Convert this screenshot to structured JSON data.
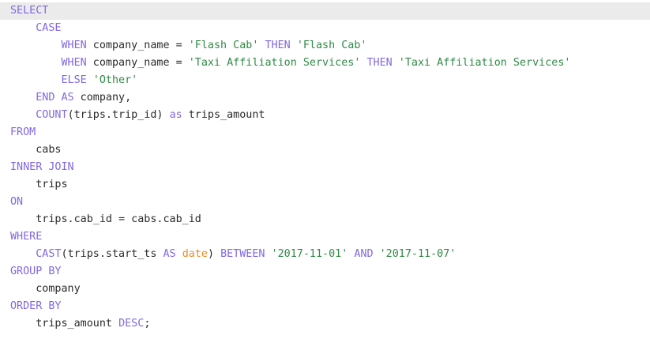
{
  "editor": {
    "active_line": 0,
    "colors": {
      "keyword": "#8268e0",
      "string": "#2f8a46",
      "type": "#ee8a1a",
      "text": "#2b2b2b",
      "active_line_bg": "#ebebeb"
    },
    "lines": [
      {
        "indent": 0,
        "tokens": [
          {
            "t": "kw",
            "v": "SELECT"
          }
        ]
      },
      {
        "indent": 4,
        "tokens": [
          {
            "t": "kw",
            "v": "CASE"
          }
        ]
      },
      {
        "indent": 8,
        "tokens": [
          {
            "t": "kw",
            "v": "WHEN"
          },
          {
            "t": "tx",
            "v": " company_name = "
          },
          {
            "t": "str",
            "v": "'Flash Cab'"
          },
          {
            "t": "tx",
            "v": " "
          },
          {
            "t": "kw",
            "v": "THEN"
          },
          {
            "t": "tx",
            "v": " "
          },
          {
            "t": "str",
            "v": "'Flash Cab'"
          }
        ]
      },
      {
        "indent": 8,
        "tokens": [
          {
            "t": "kw",
            "v": "WHEN"
          },
          {
            "t": "tx",
            "v": " company_name = "
          },
          {
            "t": "str",
            "v": "'Taxi Affiliation Services'"
          },
          {
            "t": "tx",
            "v": " "
          },
          {
            "t": "kw",
            "v": "THEN"
          },
          {
            "t": "tx",
            "v": " "
          },
          {
            "t": "str",
            "v": "'Taxi Affiliation Services'"
          }
        ]
      },
      {
        "indent": 8,
        "tokens": [
          {
            "t": "kw",
            "v": "ELSE"
          },
          {
            "t": "tx",
            "v": " "
          },
          {
            "t": "str",
            "v": "'Other'"
          }
        ]
      },
      {
        "indent": 4,
        "tokens": [
          {
            "t": "kw",
            "v": "END AS"
          },
          {
            "t": "tx",
            "v": " company,"
          }
        ]
      },
      {
        "indent": 4,
        "tokens": [
          {
            "t": "kw",
            "v": "COUNT"
          },
          {
            "t": "tx",
            "v": "(trips.trip_id) "
          },
          {
            "t": "kw",
            "v": "as"
          },
          {
            "t": "tx",
            "v": " trips_amount"
          }
        ]
      },
      {
        "indent": 0,
        "tokens": [
          {
            "t": "kw",
            "v": "FROM"
          }
        ]
      },
      {
        "indent": 4,
        "tokens": [
          {
            "t": "tx",
            "v": "cabs"
          }
        ]
      },
      {
        "indent": 0,
        "tokens": [
          {
            "t": "kw",
            "v": "INNER JOIN"
          }
        ]
      },
      {
        "indent": 4,
        "tokens": [
          {
            "t": "tx",
            "v": "trips"
          }
        ]
      },
      {
        "indent": 0,
        "tokens": [
          {
            "t": "kw",
            "v": "ON"
          }
        ]
      },
      {
        "indent": 4,
        "tokens": [
          {
            "t": "tx",
            "v": "trips.cab_id = cabs.cab_id"
          }
        ]
      },
      {
        "indent": 0,
        "tokens": [
          {
            "t": "kw",
            "v": "WHERE"
          }
        ]
      },
      {
        "indent": 4,
        "tokens": [
          {
            "t": "kw",
            "v": "CAST"
          },
          {
            "t": "tx",
            "v": "(trips.start_ts "
          },
          {
            "t": "kw",
            "v": "AS"
          },
          {
            "t": "tx",
            "v": " "
          },
          {
            "t": "ty",
            "v": "date"
          },
          {
            "t": "tx",
            "v": ") "
          },
          {
            "t": "kw",
            "v": "BETWEEN"
          },
          {
            "t": "tx",
            "v": " "
          },
          {
            "t": "str",
            "v": "'2017-11-01'"
          },
          {
            "t": "tx",
            "v": " "
          },
          {
            "t": "kw",
            "v": "AND"
          },
          {
            "t": "tx",
            "v": " "
          },
          {
            "t": "str",
            "v": "'2017-11-07'"
          }
        ]
      },
      {
        "indent": 0,
        "tokens": [
          {
            "t": "kw",
            "v": "GROUP BY"
          }
        ]
      },
      {
        "indent": 4,
        "tokens": [
          {
            "t": "tx",
            "v": "company"
          }
        ]
      },
      {
        "indent": 0,
        "tokens": [
          {
            "t": "kw",
            "v": "ORDER BY"
          }
        ]
      },
      {
        "indent": 4,
        "tokens": [
          {
            "t": "tx",
            "v": "trips_amount "
          },
          {
            "t": "kw",
            "v": "DESC"
          },
          {
            "t": "tx",
            "v": ";"
          }
        ]
      }
    ]
  }
}
